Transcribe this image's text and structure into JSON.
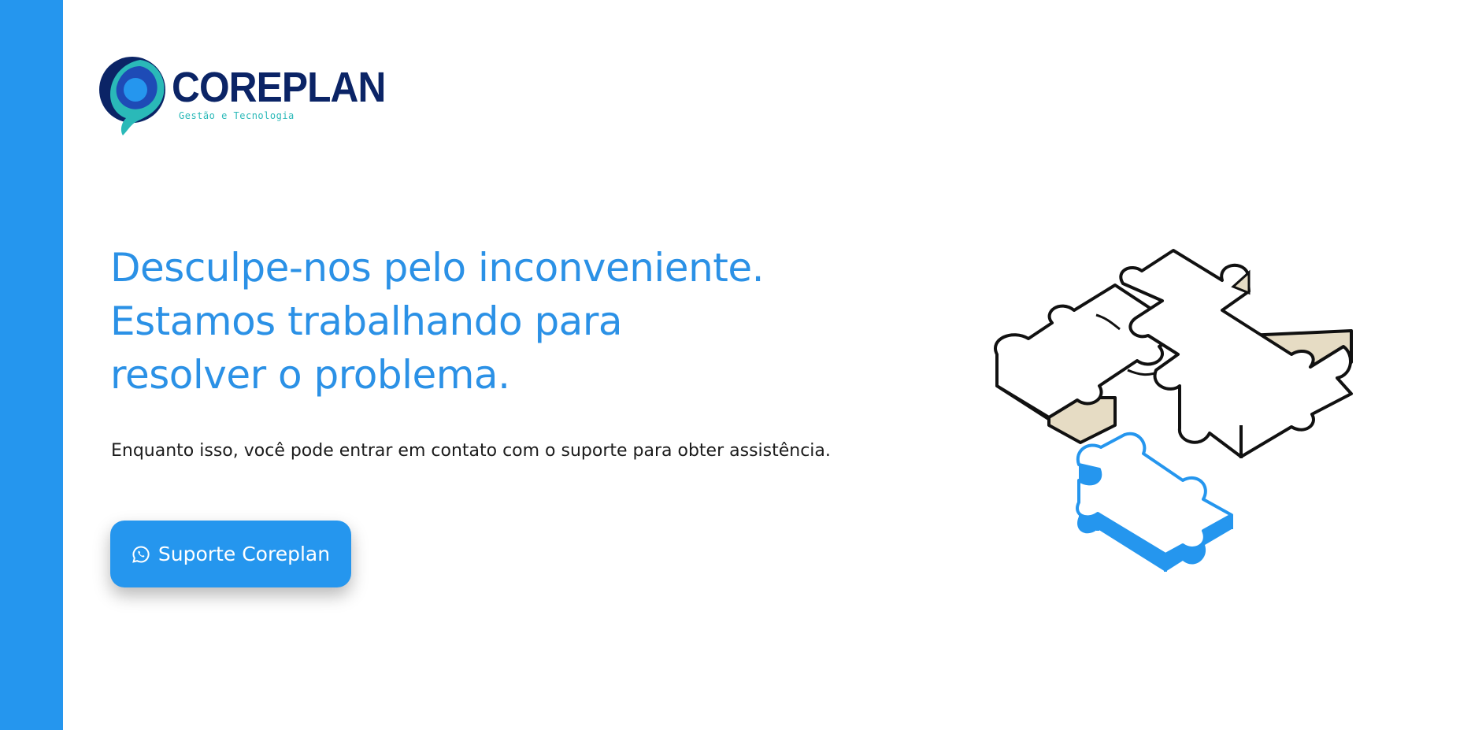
{
  "brand": {
    "name": "COREPLAN",
    "tagline": "Gestão e Tecnologia",
    "colors": {
      "primary": "#2596ee",
      "navy": "#0b2466",
      "teal": "#2ab9b8"
    }
  },
  "message": {
    "headline_lines": [
      "Desculpe-nos pelo inconveniente.",
      "Estamos trabalhando para",
      "resolver o problema."
    ],
    "subtext": "Enquanto isso, você pode entrar em contato com o suporte para obter assistência."
  },
  "support_button": {
    "label": "Suporte Coreplan",
    "icon": "whatsapp-icon"
  },
  "illustration": {
    "icon": "puzzle-pieces-illustration"
  }
}
